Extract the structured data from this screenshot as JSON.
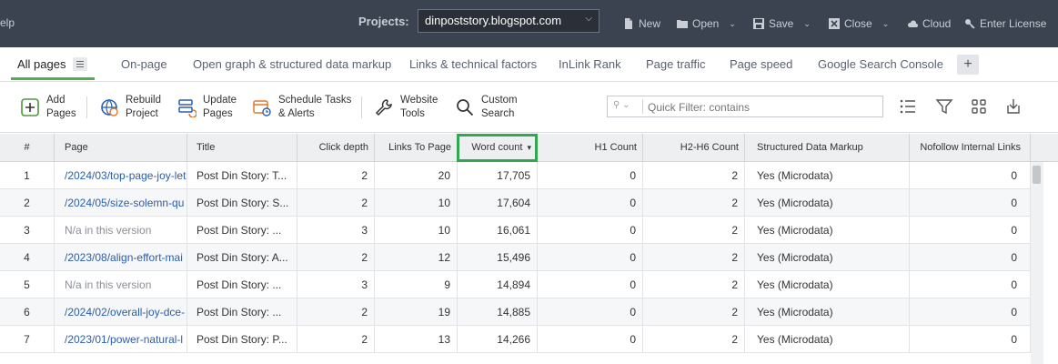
{
  "topbar": {
    "help_label": "elp",
    "projects_label": "Projects:",
    "project_selected": "dinpoststory.blogspot.com",
    "buttons": {
      "new": "New",
      "open": "Open",
      "save": "Save",
      "close": "Close",
      "cloud": "Cloud",
      "license": "Enter License"
    }
  },
  "tabs": [
    "All pages",
    "On-page",
    "Open graph & structured data markup",
    "Links & technical factors",
    "InLink Rank",
    "Page traffic",
    "Page speed",
    "Google Search Console"
  ],
  "toolbar": {
    "add_pages": [
      "Add",
      "Pages"
    ],
    "rebuild_project": [
      "Rebuild",
      "Project"
    ],
    "update_pages": [
      "Update",
      "Pages"
    ],
    "schedule_tasks": [
      "Schedule Tasks",
      "& Alerts"
    ],
    "website_tools": [
      "Website",
      "Tools"
    ],
    "custom_search": [
      "Custom",
      "Search"
    ],
    "quick_filter_placeholder": "Quick Filter: contains"
  },
  "colors": {
    "topbar_bg": "#3b4250",
    "accent_green": "#2fa84f",
    "link_blue": "#2a5db0"
  },
  "grid": {
    "columns": {
      "num": "#",
      "page": "Page",
      "title": "Title",
      "click_depth": "Click depth",
      "links_to_page": "Links To Page",
      "word_count": "Word count",
      "h1_count": "H1 Count",
      "h2_h6_count": "H2-H6 Count",
      "structured": "Structured Data Markup",
      "nofollow": "Nofollow Internal Links"
    },
    "sort_indicator": "▾",
    "rows": [
      {
        "num": "1",
        "page": "/2024/03/top-page-joy-let",
        "title": "Post Din Story: T...",
        "click_depth": "2",
        "links": "20",
        "words": "17,705",
        "h1": "0",
        "h2": "2",
        "sdm": "Yes (Microdata)",
        "nofollow": "0"
      },
      {
        "num": "2",
        "page": "/2024/05/size-solemn-qu",
        "title": "Post Din Story: S...",
        "click_depth": "2",
        "links": "10",
        "words": "17,604",
        "h1": "0",
        "h2": "2",
        "sdm": "Yes (Microdata)",
        "nofollow": "0"
      },
      {
        "num": "3",
        "page": "N/a in this version",
        "title": "Post Din Story: ...",
        "click_depth": "3",
        "links": "10",
        "words": "16,061",
        "h1": "0",
        "h2": "2",
        "sdm": "Yes (Microdata)",
        "nofollow": "0"
      },
      {
        "num": "4",
        "page": "/2023/08/align-effort-mai",
        "title": "Post Din Story: A...",
        "click_depth": "2",
        "links": "12",
        "words": "15,496",
        "h1": "0",
        "h2": "2",
        "sdm": "Yes (Microdata)",
        "nofollow": "0"
      },
      {
        "num": "5",
        "page": "N/a in this version",
        "title": "Post Din Story: ...",
        "click_depth": "3",
        "links": "9",
        "words": "14,894",
        "h1": "0",
        "h2": "2",
        "sdm": "Yes (Microdata)",
        "nofollow": "0"
      },
      {
        "num": "6",
        "page": "/2024/02/overall-joy-dce-",
        "title": "Post Din Story: ...",
        "click_depth": "2",
        "links": "19",
        "words": "14,885",
        "h1": "0",
        "h2": "2",
        "sdm": "Yes (Microdata)",
        "nofollow": "0"
      },
      {
        "num": "7",
        "page": "/2023/01/power-natural-l",
        "title": "Post Din Story: P...",
        "click_depth": "2",
        "links": "13",
        "words": "14,266",
        "h1": "0",
        "h2": "2",
        "sdm": "Yes (Microdata)",
        "nofollow": "0"
      }
    ]
  }
}
